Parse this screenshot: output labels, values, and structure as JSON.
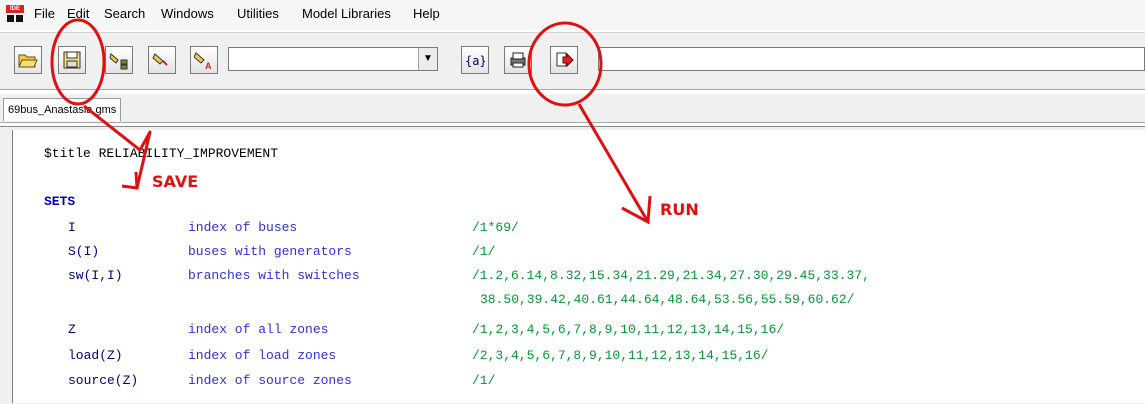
{
  "app": {
    "icon_label": "IDE"
  },
  "menu": [
    "File",
    "Edit",
    "Search",
    "Windows",
    "Utilities",
    "Model Libraries",
    "Help"
  ],
  "toolbar": {
    "combo_value": "",
    "path_value": ""
  },
  "tab": {
    "label": "69bus_Anastasia.gms"
  },
  "code": {
    "title_line": "$title RELIABILITY_IMPROVEMENT",
    "sets_kw": "SETS",
    "rows": [
      {
        "id": "I",
        "desc": "index of buses",
        "val": "/1*69/"
      },
      {
        "id": "S(I)",
        "desc": "buses with generators",
        "val": "/1/"
      },
      {
        "id": "sw(I,I)",
        "desc": "branches with switches",
        "val": "/1.2,6.14,8.32,15.34,21.29,21.34,27.30,29.45,33.37,"
      },
      {
        "id": "",
        "desc": "",
        "val": "38.50,39.42,40.61,44.64,48.64,53.56,55.59,60.62/"
      },
      {
        "id": "Z",
        "desc": "index of all zones",
        "val": "/1,2,3,4,5,6,7,8,9,10,11,12,13,14,15,16/"
      },
      {
        "id": "load(Z)",
        "desc": "index of load zones",
        "val": "/2,3,4,5,6,7,8,9,10,11,12,13,14,15,16/"
      },
      {
        "id": "source(Z)",
        "desc": "index of source zones",
        "val": "/1/"
      }
    ]
  },
  "annotations": {
    "save": "SAVE",
    "run": "RUN",
    "color": "#e01010"
  }
}
